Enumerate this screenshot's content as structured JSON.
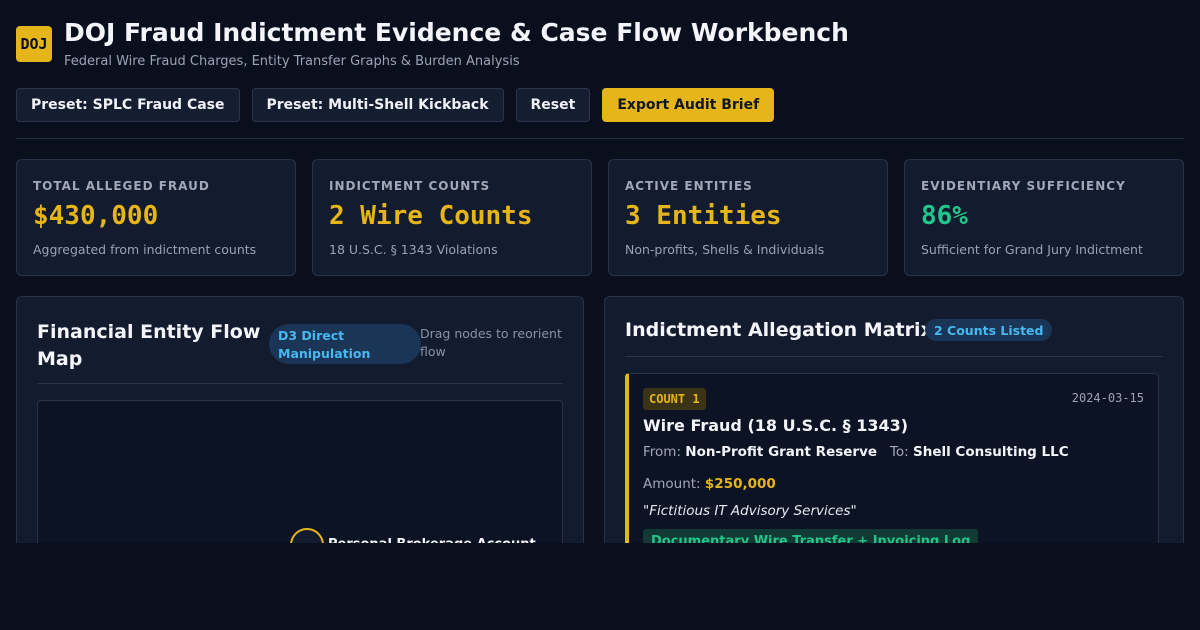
{
  "header": {
    "logo": "DOJ",
    "title": "DOJ Fraud Indictment Evidence & Case Flow Workbench",
    "subtitle": "Federal Wire Fraud Charges, Entity Transfer Graphs & Burden Analysis"
  },
  "toolbar": {
    "preset_splc": "Preset: SPLC Fraud Case",
    "preset_shell": "Preset: Multi-Shell Kickback",
    "reset": "Reset",
    "export": "Export Audit Brief"
  },
  "stats": [
    {
      "label": "TOTAL ALLEGED FRAUD",
      "value": "$430,000",
      "note": "Aggregated from indictment counts"
    },
    {
      "label": "INDICTMENT COUNTS",
      "value": "2 Wire Counts",
      "note": "18 U.S.C. § 1343 Violations"
    },
    {
      "label": "ACTIVE ENTITIES",
      "value": "3 Entities",
      "note": "Non-profits, Shells & Individuals"
    },
    {
      "label": "EVIDENTIARY SUFFICIENCY",
      "value": "86%",
      "note": "Sufficient for Grand Jury Indictment"
    }
  ],
  "flow": {
    "title": "Financial Entity Flow Map",
    "badge": "D3 Direct Manipulation",
    "hint": "Drag nodes to reorient flow",
    "node_label": "Personal Brokerage Account"
  },
  "matrix": {
    "title": "Indictment Allegation Matrix",
    "badge": "2 Counts Listed",
    "counts": [
      {
        "tag": "COUNT 1",
        "date": "2024-03-15",
        "title": "Wire Fraud (18 U.S.C. § 1343)",
        "from_label": "From:",
        "from": "Non-Profit Grant Reserve",
        "to_label": "To:",
        "to": "Shell Consulting LLC",
        "amount_label": "Amount:",
        "amount": "$250,000",
        "memo": "\"Fictitious IT Advisory Services\"",
        "evidence": "Documentary Wire Transfer + Invoicing Log"
      }
    ]
  },
  "colors": {
    "background": "#0a0f1e",
    "panel": "#131b2e",
    "accent": "#e5b519",
    "success": "#22c58b",
    "info": "#47b8f0"
  }
}
